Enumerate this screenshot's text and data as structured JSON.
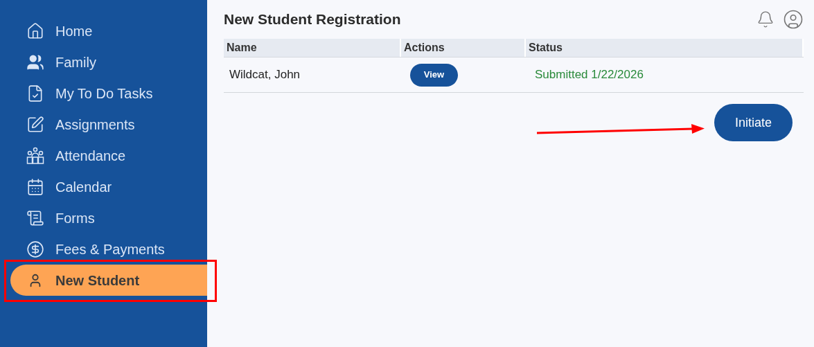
{
  "sidebar": {
    "items": [
      {
        "label": "Home",
        "selected": false
      },
      {
        "label": "Family",
        "selected": false
      },
      {
        "label": "My To Do Tasks",
        "selected": false
      },
      {
        "label": "Assignments",
        "selected": false
      },
      {
        "label": "Attendance",
        "selected": false
      },
      {
        "label": "Calendar",
        "selected": false
      },
      {
        "label": "Forms",
        "selected": false
      },
      {
        "label": "Fees & Payments",
        "selected": false
      },
      {
        "label": "New Student",
        "selected": true
      }
    ]
  },
  "page": {
    "title": "New Student Registration"
  },
  "table": {
    "columns": [
      "Name",
      "Actions",
      "Status"
    ],
    "rows": [
      {
        "name": "Wildcat, John",
        "action": "View",
        "status": "Submitted 1/22/2026"
      }
    ]
  },
  "initiate_button": "Initiate"
}
